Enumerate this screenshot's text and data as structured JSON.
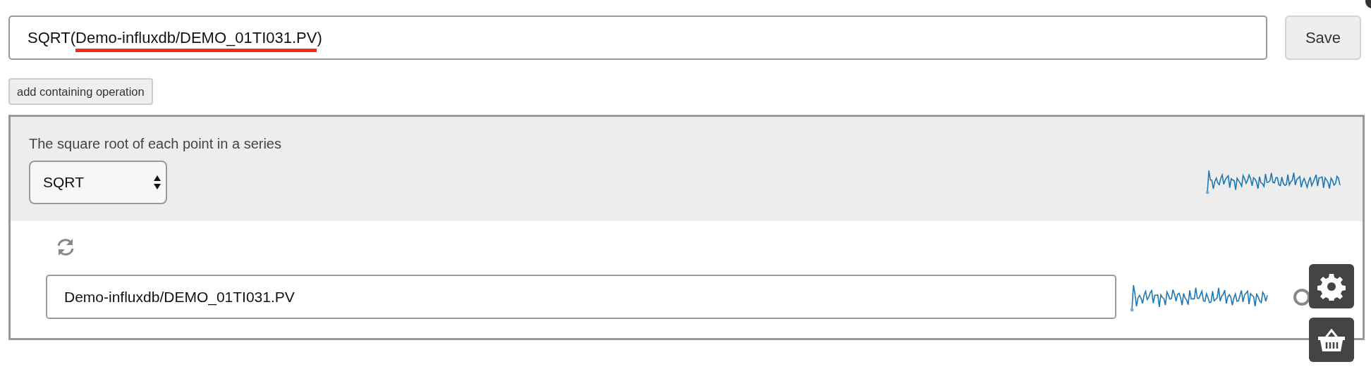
{
  "formula": {
    "value_parts": [
      {
        "text": "SQRT(",
        "underlined": false
      },
      {
        "text": "Demo-influxdb/DEMO_01TI031.PV",
        "underlined": true
      },
      {
        "text": ")",
        "underlined": false
      }
    ]
  },
  "save_button": "Save",
  "add_operation_button": "add containing operation",
  "operation": {
    "description": "The square root of each point in a series",
    "function_select": "SQRT"
  },
  "input_series": {
    "value": "Demo-influxdb/DEMO_01TI031.PV"
  }
}
